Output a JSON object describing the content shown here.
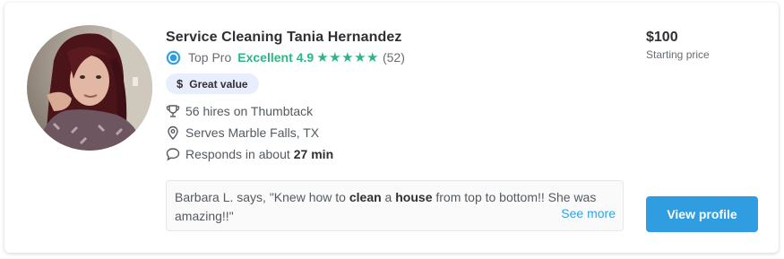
{
  "pro": {
    "name": "Service Cleaning Tania Hernandez",
    "top_pro_label": "Top Pro",
    "rating_word": "Excellent",
    "rating_score": "4.9",
    "stars": 5,
    "review_count": "(52)",
    "badge": "Great value",
    "facts": {
      "hires": "56 hires on Thumbtack",
      "serves": "Serves Marble Falls, TX",
      "responds_prefix": "Responds in about",
      "responds_time": "27 min"
    }
  },
  "review": {
    "part1": "Barbara L. says, \"Knew how to ",
    "bold1": "clean",
    "part2": " a ",
    "bold2": "house",
    "part3": " from top to bottom!! She was amazing!!\"",
    "see_more": "See more"
  },
  "pricing": {
    "price": "$100",
    "subtitle": "Starting price"
  },
  "actions": {
    "view_profile": "View profile"
  },
  "icons": {
    "top_pro": "top-pro-badge-icon",
    "badge": "dollar-icon",
    "hires": "trophy-icon",
    "serves": "map-pin-icon",
    "responds": "chat-bubble-icon"
  },
  "colors": {
    "rating_green": "#2db783",
    "link_blue": "#2da5e3",
    "button_blue": "#2f9de0",
    "badge_bg": "#e9eefe"
  }
}
